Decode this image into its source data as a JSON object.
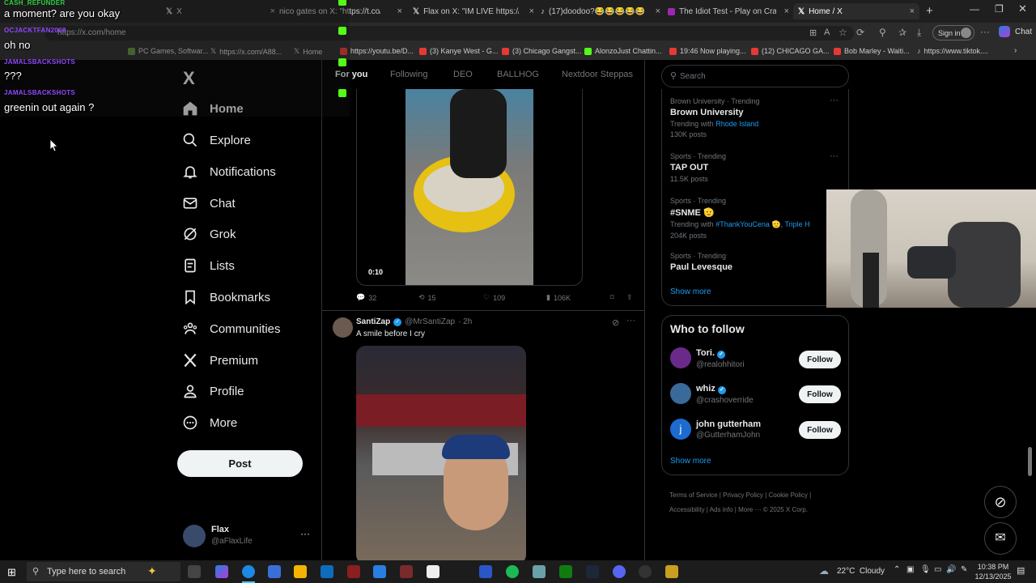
{
  "browser": {
    "tabs": [
      {
        "title": "",
        "close": "×"
      },
      {
        "title": "X",
        "close": "×"
      },
      {
        "title": "nico gates on X: \"https://t.co/wQ",
        "close": "×"
      },
      {
        "title": "Flax on X: \"IM LIVE https://t.co/7G",
        "close": "×"
      },
      {
        "title": "(17)doodoo?😂😂😂😂😂😂",
        "close": "×"
      },
      {
        "title": "The Idiot Test - Play on CrazyGa",
        "close": "×"
      },
      {
        "title": "Home / X",
        "close": "×"
      }
    ],
    "new_tab": "+",
    "url": "https://x.com/home",
    "signin_label": "Sign in",
    "chat_label": "Chat",
    "bookmarks": [
      "PC Games, Softwar...",
      "https://x.com/A88...",
      "Home",
      "https://youtu.be/D...",
      "(3) Kanye West - G...",
      "(3) Chicago Gangst...",
      "AlonzoJust Chattin...",
      "19:46 Now playing...",
      "(12) CHICAGO GA...",
      "Bob Marley - Waiti...",
      "https://www.tiktok...."
    ]
  },
  "chat_overlay": [
    {
      "user": "CASH_REFUNDER",
      "message": "a moment? are you okay"
    },
    {
      "user": "OCJACKTFAN2008",
      "message": "oh no"
    },
    {
      "user": "JAMALSBACKSHOTS",
      "message": "???"
    },
    {
      "user": "JAMALSBACKSHOTS",
      "message": "greenin out again ?"
    }
  ],
  "sidebar": {
    "logo": "X",
    "items": [
      {
        "label": "Home",
        "icon": "home-icon"
      },
      {
        "label": "Explore",
        "icon": "search-icon"
      },
      {
        "label": "Notifications",
        "icon": "bell-icon"
      },
      {
        "label": "Chat",
        "icon": "mail-icon"
      },
      {
        "label": "Grok",
        "icon": "grok-icon"
      },
      {
        "label": "Lists",
        "icon": "list-icon"
      },
      {
        "label": "Bookmarks",
        "icon": "bookmark-icon"
      },
      {
        "label": "Communities",
        "icon": "people-icon"
      },
      {
        "label": "Premium",
        "icon": "x-icon"
      },
      {
        "label": "Profile",
        "icon": "person-icon"
      },
      {
        "label": "More",
        "icon": "more-icon"
      }
    ],
    "post_label": "Post",
    "account": {
      "name": "Flax",
      "handle": "@aFlaxLife",
      "more": "···"
    }
  },
  "feed": {
    "tabs": [
      "For you",
      "Following",
      "DEO",
      "BALLHOG",
      "Nextdoor Steppas"
    ],
    "video_tweet": {
      "duration": "0:10",
      "replies": "32",
      "reposts": "15",
      "likes": "109",
      "views": "106K"
    },
    "tweet": {
      "name": "SantiZap",
      "handle": "@MrSantiZap",
      "time": "· 2h",
      "text": "A smile before I cry"
    }
  },
  "right": {
    "search_placeholder": "Search",
    "trends": [
      {
        "meta": "Brown University · Trending",
        "title": "Brown University",
        "with": "Trending with",
        "with_link": "Rhode Island",
        "count": "130K posts"
      },
      {
        "meta": "Sports · Trending",
        "title": "TAP OUT",
        "count": "11.5K posts"
      },
      {
        "meta": "Sports · Trending",
        "title": "#SNME 🫡",
        "with": "Trending with",
        "with_link": "#ThankYouCena 🫡, Triple H",
        "count": "204K posts"
      },
      {
        "meta": "Sports · Trending",
        "title": "Paul Levesque"
      }
    ],
    "show_more": "Show more",
    "who_to_follow_title": "Who to follow",
    "who_to_follow": [
      {
        "name": "Tori.",
        "handle": "@realohhitori",
        "button": "Follow"
      },
      {
        "name": "whiz",
        "handle": "@crashoverride",
        "button": "Follow"
      },
      {
        "name": "john gutterham",
        "handle": "@GutterhamJohn",
        "button": "Follow"
      }
    ],
    "show_more_2": "Show more",
    "footer": [
      "Terms of Service",
      "Privacy Policy",
      "Cookie Policy",
      "Accessibility",
      "Ads info",
      "More ···",
      "© 2025 X Corp."
    ]
  },
  "taskbar": {
    "search_placeholder": "Type here to search",
    "weather": "22°C  Cloudy",
    "time": "10:38 PM",
    "date": "12/13/2025"
  },
  "colors": {
    "accent": "#1d9bf0",
    "chat_name": "#9147ff",
    "verified": "#1d9bf0"
  }
}
